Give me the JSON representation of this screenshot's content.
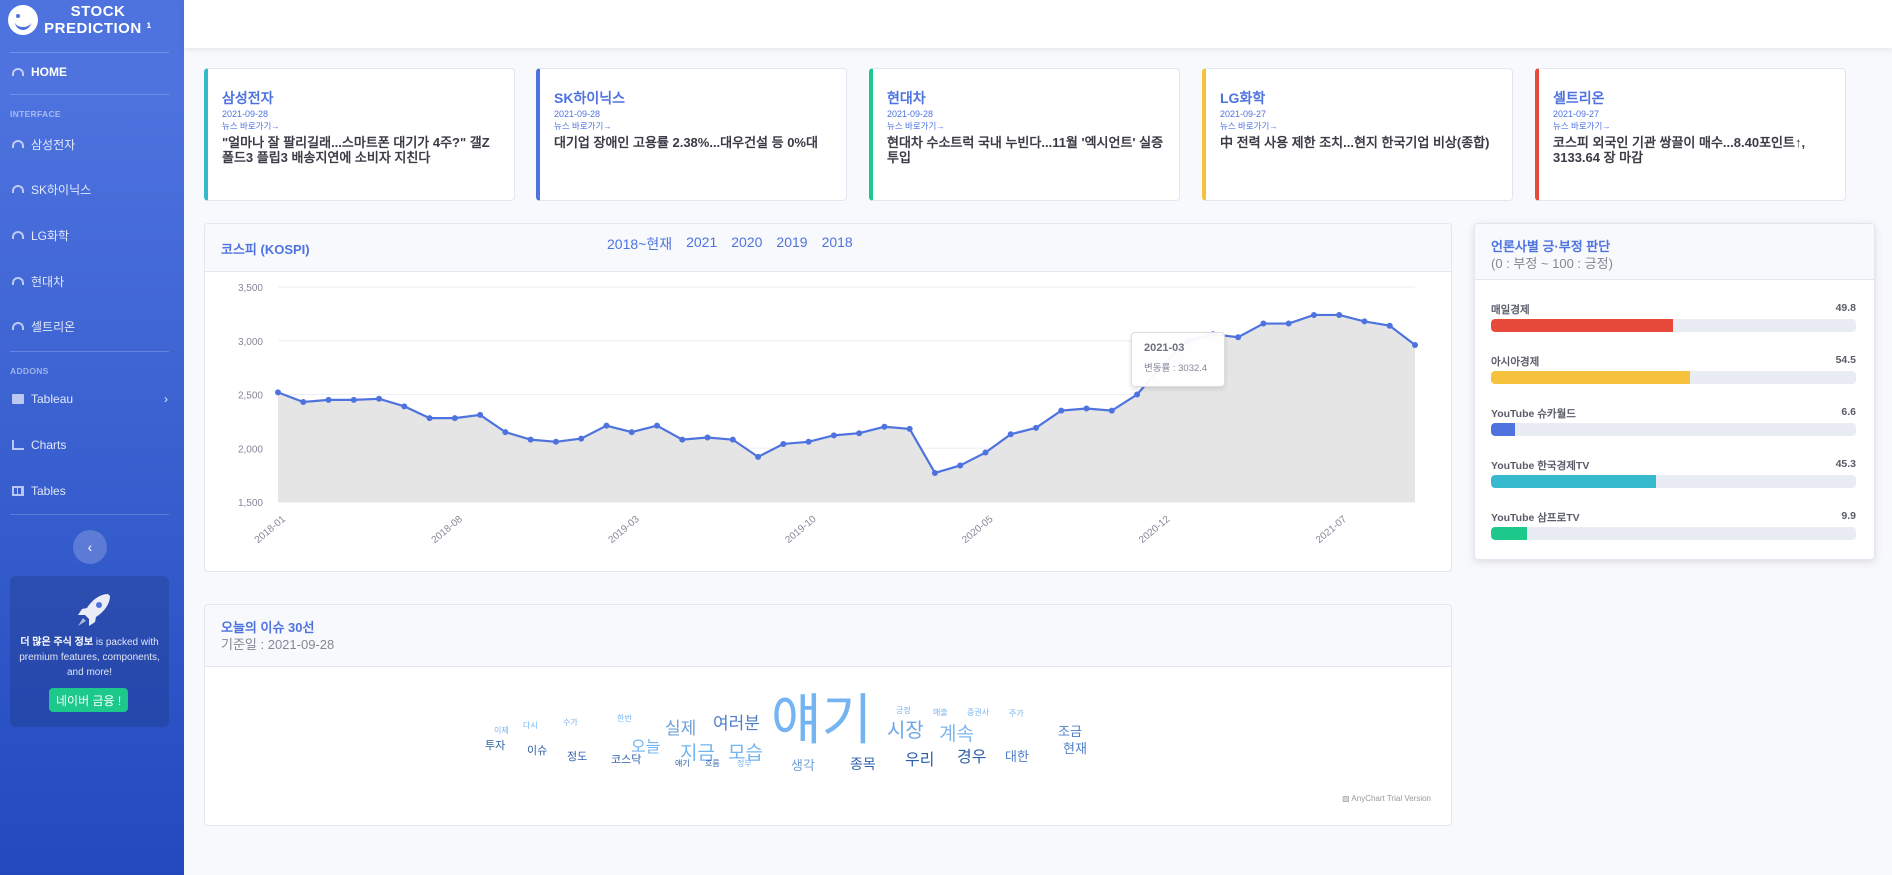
{
  "brand": {
    "line1": "STOCK",
    "line2": "PREDICTION ¹"
  },
  "sidebar": {
    "home": "HOME",
    "heading_interface": "INTERFACE",
    "stocks": [
      "삼성전자",
      "SK하이닉스",
      "LG화학",
      "현대차",
      "셀트리온"
    ],
    "heading_addons": "ADDONS",
    "addons": [
      "Tableau",
      "Charts",
      "Tables"
    ],
    "promo": {
      "text_bold": "더 많은 주식 정보",
      "text_rest": "is packed with premium features, components, and more!",
      "button": "네이버 금융 !"
    }
  },
  "news": [
    {
      "company": "삼성전자",
      "date": "2021-09-28",
      "link": "뉴스 바로가기→",
      "headline": "\"얼마나 잘 팔리길래...스마트폰 대기가 4주?\" 갤Z폴드3 플립3 배송지연에 소비자 지친다",
      "color": "#36b9cc"
    },
    {
      "company": "SK하이닉스",
      "date": "2021-09-28",
      "link": "뉴스 바로가기→",
      "headline": "대기업 장애인 고용률 2.38%...대우건설 등 0%대",
      "color": "#4e73df"
    },
    {
      "company": "현대차",
      "date": "2021-09-28",
      "link": "뉴스 바로가기→",
      "headline": "현대차 수소트럭 국내 누빈다...11월 '엑시언트' 실증 투입",
      "color": "#1cc88a"
    },
    {
      "company": "LG화학",
      "date": "2021-09-27",
      "link": "뉴스 바로가기→",
      "headline": "中 전력 사용 제한 조치...현지 한국기업 비상(종합)",
      "color": "#f6c23e"
    },
    {
      "company": "셀트리온",
      "date": "2021-09-27",
      "link": "뉴스 바로가기→",
      "headline": "코스피 외국인 기관 쌍끌이 매수...8.40포인트↑, 3133.64 장 마감",
      "color": "#e74a3b"
    }
  ],
  "kospi": {
    "title": "코스피 (KOSPI)",
    "tabs": [
      "2018~현재",
      "2021",
      "2020",
      "2019",
      "2018"
    ],
    "tooltip": {
      "label": "2021-03",
      "value": "변동률 : 3032.4"
    }
  },
  "chart_data": {
    "type": "area",
    "x": [
      "2018-01",
      "2018-02",
      "2018-03",
      "2018-04",
      "2018-05",
      "2018-06",
      "2018-07",
      "2018-08",
      "2018-09",
      "2018-10",
      "2018-11",
      "2018-12",
      "2019-01",
      "2019-02",
      "2019-03",
      "2019-04",
      "2019-05",
      "2019-06",
      "2019-07",
      "2019-08",
      "2019-09",
      "2019-10",
      "2019-11",
      "2019-12",
      "2020-01",
      "2020-02",
      "2020-03",
      "2020-04",
      "2020-05",
      "2020-06",
      "2020-07",
      "2020-08",
      "2020-09",
      "2020-10",
      "2020-11",
      "2020-12",
      "2021-01",
      "2021-02",
      "2021-03",
      "2021-04",
      "2021-05",
      "2021-06",
      "2021-07",
      "2021-08",
      "2021-09",
      "2021-10"
    ],
    "values": [
      2520,
      2430,
      2450,
      2450,
      2460,
      2390,
      2280,
      2280,
      2310,
      2150,
      2080,
      2060,
      2090,
      2210,
      2150,
      2210,
      2080,
      2100,
      2080,
      1920,
      2040,
      2060,
      2120,
      2140,
      2200,
      2180,
      1770,
      1840,
      1960,
      2130,
      2190,
      2350,
      2370,
      2350,
      2500,
      2770,
      3000,
      3060,
      3032.4,
      3160,
      3160,
      3240,
      3240,
      3180,
      3140,
      2960
    ],
    "ticks_x": [
      "2018-01",
      "2018-08",
      "2019-03",
      "2019-10",
      "2020-05",
      "2020-12",
      "2021-07"
    ],
    "ticks_y": [
      "1,500",
      "2,000",
      "2,500",
      "3,000",
      "3,500"
    ],
    "ylim": [
      1500,
      3500
    ],
    "colors": {
      "line": "#4e73df",
      "fill": "#e5e5e5"
    },
    "grid": "horizontal"
  },
  "sentiment": {
    "title": "언론사별 긍·부정 판단",
    "subtitle": "(0 : 부정 ~ 100 : 긍정)",
    "items": [
      {
        "name": "매일경제",
        "value": 49.8,
        "color": "#e74a3b"
      },
      {
        "name": "아시아경제",
        "value": 54.5,
        "color": "#f6c23e"
      },
      {
        "name": "YouTube 슈카월드",
        "value": 6.6,
        "color": "#4e73df"
      },
      {
        "name": "YouTube 한국경제TV",
        "value": 45.3,
        "color": "#36b9cc"
      },
      {
        "name": "YouTube 삼프로TV",
        "value": 9.9,
        "color": "#1cc88a"
      }
    ]
  },
  "issue": {
    "title": "오늘의 이슈 30선",
    "date": "기준일 : 2021-09-28",
    "credit": "AnyChart Trial Version",
    "words": [
      "얘기",
      "시장",
      "계속",
      "여러분",
      "실제",
      "지금",
      "모습",
      "오늘",
      "우리",
      "경우",
      "생각",
      "종목",
      "조금",
      "현재",
      "대한",
      "투자",
      "이슈",
      "정도",
      "코스닥",
      "이제",
      "다시",
      "수가",
      "한번",
      "긍정",
      "매출",
      "증권사",
      "주가",
      "얘기",
      "흐름",
      "정부"
    ]
  }
}
